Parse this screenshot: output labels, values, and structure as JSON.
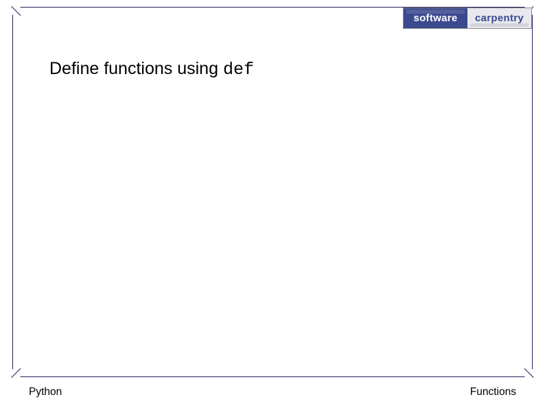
{
  "logo": {
    "left": "software",
    "right": "carpentry"
  },
  "title": {
    "prefix": "Define functions using ",
    "keyword": "def"
  },
  "footer": {
    "left": "Python",
    "right": "Functions"
  }
}
